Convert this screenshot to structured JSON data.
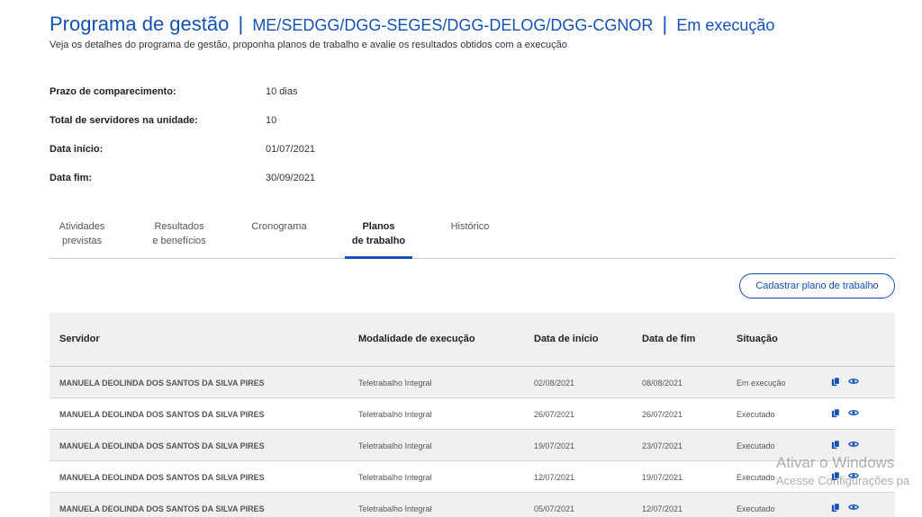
{
  "header": {
    "title_main": "Programa de gestão",
    "separator": "|",
    "title_path": "ME/SEDGG/DGG-SEGES/DGG-DELOG/DGG-CGNOR",
    "title_status": "Em execução",
    "subtitle": "Veja os detalhes do programa de gestão, proponha planos de trabalho e avalie os resultados obtidos com a execução"
  },
  "info": [
    {
      "label": "Prazo de comparecimento:",
      "value": "10 dias"
    },
    {
      "label": "Total de servidores na unidade:",
      "value": "10"
    },
    {
      "label": "Data início:",
      "value": "01/07/2021"
    },
    {
      "label": "Data fim:",
      "value": "30/09/2021"
    }
  ],
  "tabs": [
    {
      "line1": "Atividades",
      "line2": "previstas",
      "active": false
    },
    {
      "line1": "Resultados",
      "line2": "e benefícios",
      "active": false
    },
    {
      "line1": "Cronograma",
      "line2": "",
      "active": false
    },
    {
      "line1": "Planos",
      "line2": "de trabalho",
      "active": true
    },
    {
      "line1": "Histórico",
      "line2": "",
      "active": false
    }
  ],
  "actions": {
    "cadastrar_label": "Cadastrar plano de trabalho"
  },
  "table": {
    "columns": [
      "Servidor",
      "Modalidade de execução",
      "Data de início",
      "Data de fim",
      "Situação"
    ],
    "rows": [
      {
        "servidor": "MANUELA DEOLINDA DOS SANTOS DA SILVA PIRES",
        "modalidade": "Teletrabalho Integral",
        "inicio": "02/08/2021",
        "fim": "08/08/2021",
        "situacao": "Em execução"
      },
      {
        "servidor": "MANUELA DEOLINDA DOS SANTOS DA SILVA PIRES",
        "modalidade": "Teletrabalho Integral",
        "inicio": "26/07/2021",
        "fim": "26/07/2021",
        "situacao": "Executado"
      },
      {
        "servidor": "MANUELA DEOLINDA DOS SANTOS DA SILVA PIRES",
        "modalidade": "Teletrabalho Integral",
        "inicio": "19/07/2021",
        "fim": "23/07/2021",
        "situacao": "Executado"
      },
      {
        "servidor": "MANUELA DEOLINDA DOS SANTOS DA SILVA PIRES",
        "modalidade": "Teletrabalho Integral",
        "inicio": "12/07/2021",
        "fim": "19/07/2021",
        "situacao": "Executado"
      },
      {
        "servidor": "MANUELA DEOLINDA DOS SANTOS DA SILVA PIRES",
        "modalidade": "Teletrabalho Integral",
        "inicio": "05/07/2021",
        "fim": "12/07/2021",
        "situacao": "Executado"
      }
    ],
    "row_icons": [
      "copy-icon",
      "eye-icon"
    ]
  },
  "watermark": {
    "line1": "Ativar o Windows",
    "line2": "Acesse Configurações pa"
  },
  "colors": {
    "accent": "#1351b4",
    "row_alt": "#f0f0f0",
    "text": "#333333"
  }
}
